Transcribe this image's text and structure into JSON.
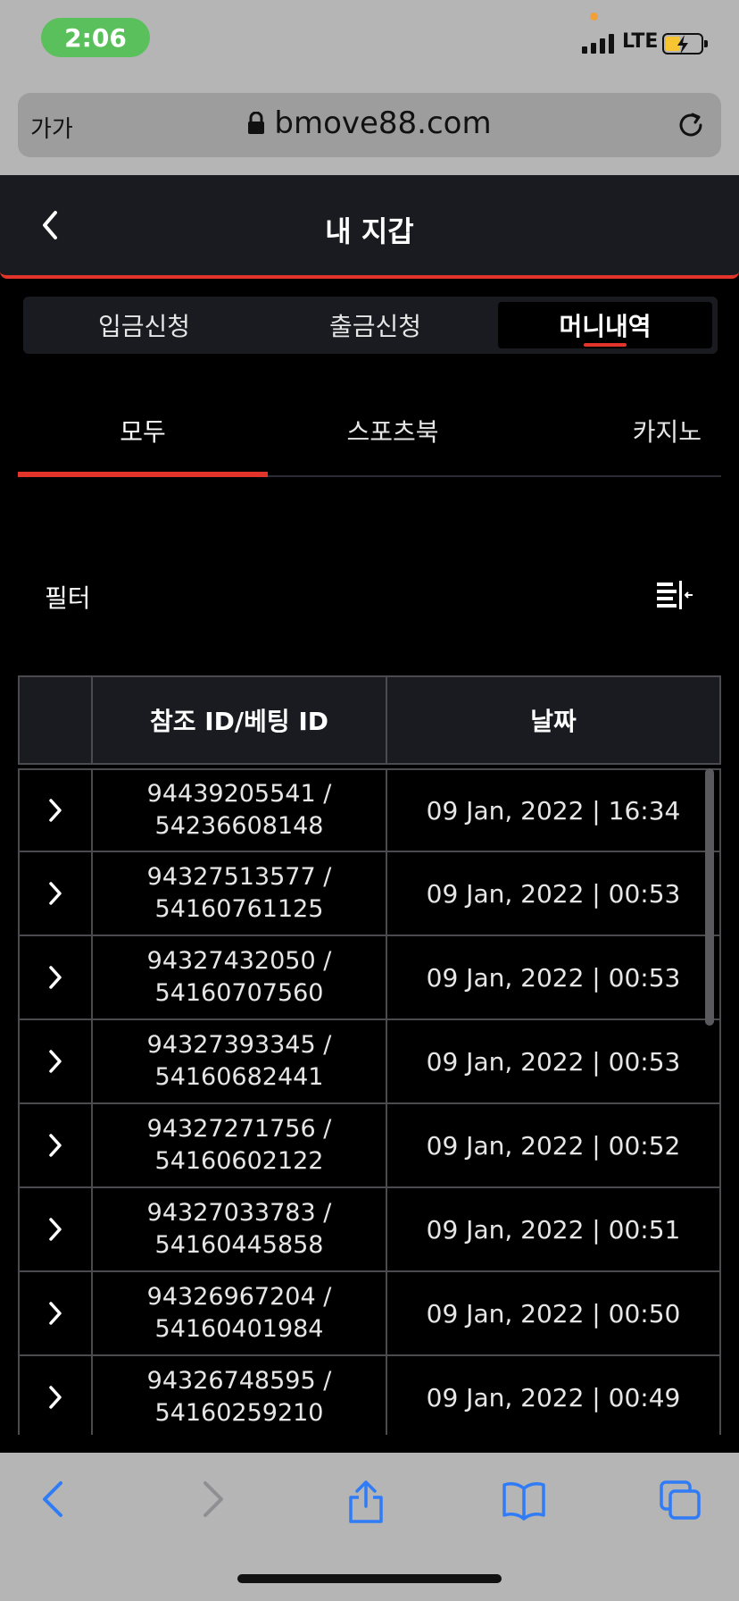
{
  "status_bar": {
    "time": "2:06",
    "network": "LTE"
  },
  "browser": {
    "text_size_label": "가가",
    "url": "bmove88.com"
  },
  "header": {
    "title": "내 지갑"
  },
  "wallet_tabs": [
    {
      "label": "입금신청",
      "active": false
    },
    {
      "label": "출금신청",
      "active": false
    },
    {
      "label": "머니내역",
      "active": true
    }
  ],
  "category_tabs": [
    {
      "label": "모두",
      "active": true
    },
    {
      "label": "스포츠북",
      "active": false
    },
    {
      "label": "카지노",
      "active": false
    }
  ],
  "filter": {
    "label": "필터"
  },
  "table": {
    "columns": [
      "",
      "참조 ID/베팅 ID",
      "날짜"
    ],
    "rows": [
      {
        "ref_id": "94439205541 /",
        "bet_id": "54236608148",
        "date": "09 Jan, 2022 | 16:34"
      },
      {
        "ref_id": "94327513577 /",
        "bet_id": "54160761125",
        "date": "09 Jan, 2022 | 00:53"
      },
      {
        "ref_id": "94327432050 /",
        "bet_id": "54160707560",
        "date": "09 Jan, 2022 | 00:53"
      },
      {
        "ref_id": "94327393345 /",
        "bet_id": "54160682441",
        "date": "09 Jan, 2022 | 00:53"
      },
      {
        "ref_id": "94327271756 /",
        "bet_id": "54160602122",
        "date": "09 Jan, 2022 | 00:52"
      },
      {
        "ref_id": "94327033783 /",
        "bet_id": "54160445858",
        "date": "09 Jan, 2022 | 00:51"
      },
      {
        "ref_id": "94326967204 /",
        "bet_id": "54160401984",
        "date": "09 Jan, 2022 | 00:50"
      },
      {
        "ref_id": "94326748595 /",
        "bet_id": "54160259210",
        "date": "09 Jan, 2022 | 00:49"
      }
    ]
  },
  "colors": {
    "accent": "#e2342b",
    "panel": "#1a1b20",
    "browser_chrome": "#b5b5b5",
    "ios_blue": "#2f7cf6"
  },
  "icons": {
    "back": "chevron-left-icon",
    "filter": "filter-list-icon",
    "row_expand": "chevron-right-icon",
    "reload": "reload-icon",
    "lock": "lock-icon"
  }
}
